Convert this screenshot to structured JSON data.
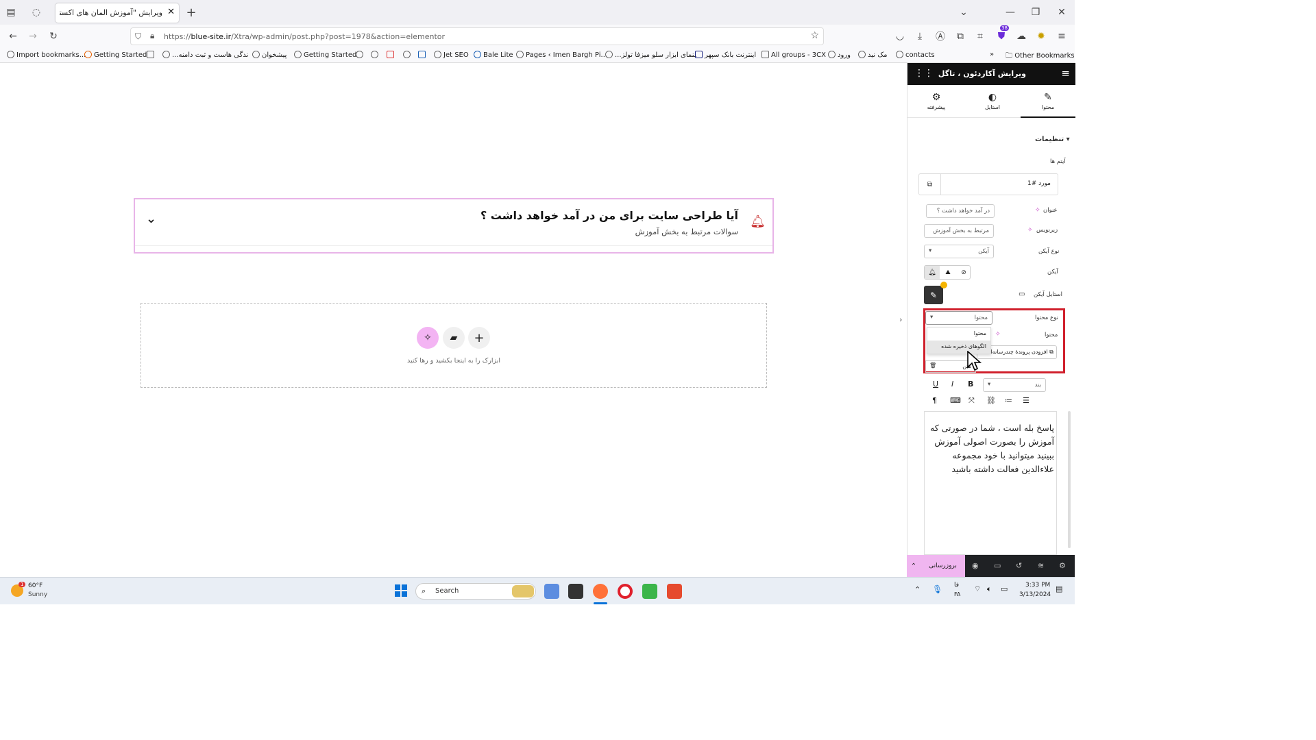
{
  "browser": {
    "tab_title": "ویرایش \"آموزش المان های اکسترا – ...",
    "url_domain": "blue-site.ir",
    "url_prefix": "https://",
    "url_path": "/Xtra/wp-admin/post.php?post=1978&action=elementor",
    "extensions_badge": "38"
  },
  "bookmarks": [
    {
      "label": "Import bookmarks..."
    },
    {
      "label": "Getting Started"
    },
    {
      "label": "...ندگی هاست و ثبت دامنه"
    },
    {
      "label": "پیشخوان"
    },
    {
      "label": "Getting Started"
    },
    {
      "label": "Jet SEO"
    },
    {
      "label": "Bale Lite"
    },
    {
      "label": "Pages ‹ Imen Bargh Pi..."
    },
    {
      "label": "...ـنمای ابزار سلو میزفا تولز"
    },
    {
      "label": "اینترنت بانک سپهر"
    },
    {
      "label": "All groups - 3CX"
    },
    {
      "label": "ورود"
    },
    {
      "label": "مک نید"
    },
    {
      "label": "contacts"
    },
    {
      "label": "Other Bookmarks"
    }
  ],
  "canvas": {
    "accordion_title": "آیا طراحی سایت برای من در آمد خواهد داشت ؟",
    "accordion_subtitle": "سوالات مرتبط به بخش آموزش",
    "drop_hint": "ابزارک را به اینجا بکشید و رها کنید"
  },
  "panel": {
    "title": "ویرایش آکاردئون ، تاگل",
    "tabs": [
      {
        "label": "محتوا"
      },
      {
        "label": "استایل"
      },
      {
        "label": "پیشرفته"
      }
    ],
    "section_title": "تنظیمات",
    "items_label": "آیتم ها",
    "item_name": "مورد #1",
    "fields": {
      "title_label": "عنوان",
      "title_value": "در آمد خواهد داشت ؟",
      "subtitle_label": "زیرنویس",
      "subtitle_value": "مرتبط به بخش آموزش",
      "icon_type_label": "نوع آیکن",
      "icon_type_value": "آیکن",
      "icon_label": "آیکن",
      "icon_style_label": "استایل آیکن",
      "content_type_label": "نوع محتوا",
      "content_type_value": "محتوا",
      "content_label": "محتوا",
      "add_media": "افزودن پروندهٔ چندرسانه‌ای",
      "format_value": "بند",
      "text_tab": "متن"
    },
    "dropdown_options": [
      "محتوا",
      "الگوهای ذخیره شده"
    ],
    "editor_text": "پاسخ بله است ، شما در صورتی که آموزش را بصورت اصولی آموزش ببینید میتوانید با خود مجموعه علاءالدین فعالت داشته باشید",
    "update_button": "بروزرسانی"
  },
  "taskbar": {
    "weather_temp": "60°F",
    "weather_desc": "Sunny",
    "weather_badge": "1",
    "search_placeholder": "Search",
    "lang_top": "فا",
    "lang_bottom": "FA",
    "time": "3:33 PM",
    "date": "3/13/2024"
  },
  "colors": {
    "accent_pink": "#f0b6f0",
    "highlight_red": "#d0202c",
    "panel_dark": "#111111"
  }
}
